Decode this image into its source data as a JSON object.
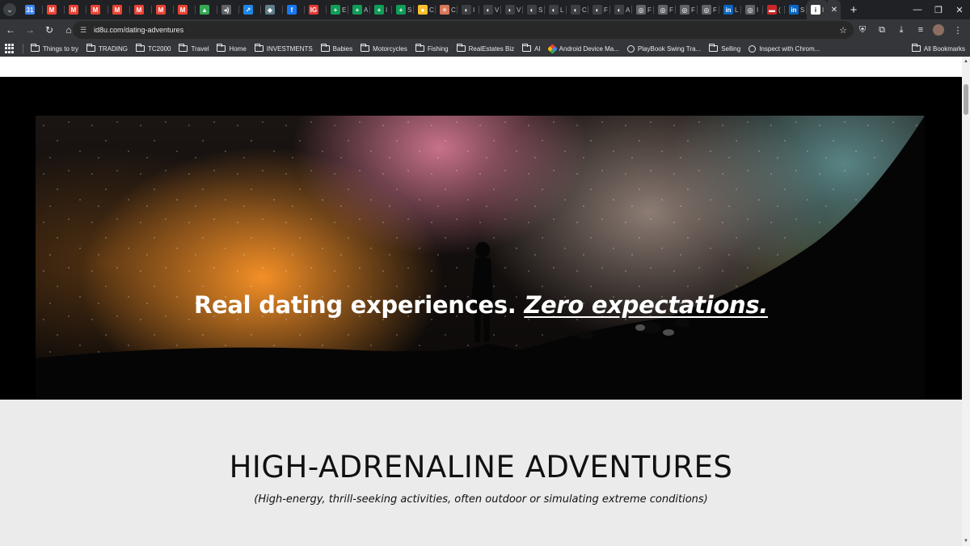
{
  "browser": {
    "tabs": [
      {
        "icon": "calendar-icon",
        "color": "#4285f4",
        "glyph": "31",
        "label": ""
      },
      {
        "icon": "gmail-icon",
        "color": "#ea4335",
        "glyph": "M",
        "label": ""
      },
      {
        "icon": "gmail-icon",
        "color": "#ea4335",
        "glyph": "M",
        "label": ""
      },
      {
        "icon": "gmail-icon",
        "color": "#ea4335",
        "glyph": "M",
        "label": ""
      },
      {
        "icon": "gmail-icon",
        "color": "#ea4335",
        "glyph": "M",
        "label": ""
      },
      {
        "icon": "gmail-icon",
        "color": "#ea4335",
        "glyph": "M",
        "label": ""
      },
      {
        "icon": "gmail-icon",
        "color": "#ea4335",
        "glyph": "M",
        "label": ""
      },
      {
        "icon": "gmail-icon",
        "color": "#ea4335",
        "glyph": "M",
        "label": ""
      },
      {
        "icon": "drive-icon",
        "color": "#34a853",
        "glyph": "▲",
        "label": ""
      },
      {
        "icon": "audio-icon",
        "color": "#5f6368",
        "glyph": "◂)",
        "label": ""
      },
      {
        "icon": "chart-tab-icon",
        "color": "#1e88e5",
        "glyph": "↗",
        "label": ""
      },
      {
        "icon": "shield-tab-icon",
        "color": "#607d8b",
        "glyph": "◆",
        "label": ""
      },
      {
        "icon": "facebook-icon",
        "color": "#1877f2",
        "glyph": "f",
        "label": ""
      },
      {
        "icon": "ig-icon",
        "color": "#e53935",
        "glyph": "IG",
        "label": ""
      },
      {
        "icon": "sheets-icon",
        "color": "#0f9d58",
        "glyph": "+",
        "label": "E"
      },
      {
        "icon": "sheets-icon",
        "color": "#0f9d58",
        "glyph": "+",
        "label": "A"
      },
      {
        "icon": "sheets-icon",
        "color": "#0f9d58",
        "glyph": "+",
        "label": "I"
      },
      {
        "icon": "sheets-icon",
        "color": "#0f9d58",
        "glyph": "+",
        "label": "S"
      },
      {
        "icon": "yellow-circle-icon",
        "color": "#fbc02d",
        "glyph": "●",
        "label": "C"
      },
      {
        "icon": "claude-icon",
        "color": "#d97757",
        "glyph": "✳",
        "label": "C"
      },
      {
        "icon": "github-icon",
        "color": "#3c4043",
        "glyph": "◐",
        "label": "I"
      },
      {
        "icon": "github-icon",
        "color": "#3c4043",
        "glyph": "◐",
        "label": "V"
      },
      {
        "icon": "github-icon",
        "color": "#3c4043",
        "glyph": "◐",
        "label": "V"
      },
      {
        "icon": "github-icon",
        "color": "#3c4043",
        "glyph": "◐",
        "label": "S"
      },
      {
        "icon": "github-icon",
        "color": "#3c4043",
        "glyph": "◐",
        "label": "L"
      },
      {
        "icon": "github-icon",
        "color": "#3c4043",
        "glyph": "◐",
        "label": "C"
      },
      {
        "icon": "github-icon",
        "color": "#3c4043",
        "glyph": "◐",
        "label": "F"
      },
      {
        "icon": "github-icon",
        "color": "#3c4043",
        "glyph": "◐",
        "label": "A"
      },
      {
        "icon": "globe-tab-icon",
        "color": "#5f6368",
        "glyph": "◎",
        "label": "F"
      },
      {
        "icon": "globe-tab-icon",
        "color": "#5f6368",
        "glyph": "◎",
        "label": "F"
      },
      {
        "icon": "globe-tab-icon",
        "color": "#5f6368",
        "glyph": "◎",
        "label": "F"
      },
      {
        "icon": "globe-tab-icon",
        "color": "#5f6368",
        "glyph": "◎",
        "label": "F"
      },
      {
        "icon": "linkedin-icon",
        "color": "#0a66c2",
        "glyph": "in",
        "label": "L"
      },
      {
        "icon": "globe-tab-icon",
        "color": "#5f6368",
        "glyph": "◎",
        "label": "I"
      },
      {
        "icon": "flag-tab-icon",
        "color": "#c62828",
        "glyph": "▬",
        "label": "("
      },
      {
        "icon": "linkedin-icon",
        "color": "#0a66c2",
        "glyph": "in",
        "label": "S"
      }
    ],
    "active_tab_label": "I",
    "active_tab_close": "✕",
    "new_tab": "+",
    "window": {
      "minimize": "—",
      "restore": "❐",
      "close": "✕"
    },
    "toolbar": {
      "back": "←",
      "forward": "→",
      "reload": "↻",
      "home": "⌂",
      "site_info": "☰",
      "url": "id8u.com/dating-adventures",
      "bookmark_star": "☆",
      "extensions": [
        "shield-ext-icon",
        "puzzle-icon",
        "download-icon",
        "media-icon"
      ],
      "extension_glyphs": [
        "⛨",
        "⧉",
        "⤓",
        "≡"
      ],
      "menu": "⋮"
    },
    "bookmarks": [
      {
        "label": "Things to try",
        "type": "folder"
      },
      {
        "label": "TRADING",
        "type": "folder"
      },
      {
        "label": "TC2000",
        "type": "folder"
      },
      {
        "label": "Travel",
        "type": "folder"
      },
      {
        "label": "Home",
        "type": "folder"
      },
      {
        "label": "INVESTMENTS",
        "type": "folder"
      },
      {
        "label": "Babies",
        "type": "folder"
      },
      {
        "label": "Motorcycles",
        "type": "folder"
      },
      {
        "label": "Fishing",
        "type": "folder"
      },
      {
        "label": "RealEstates Biz",
        "type": "folder"
      },
      {
        "label": "AI",
        "type": "folder"
      },
      {
        "label": "Android Device Ma...",
        "type": "adm"
      },
      {
        "label": "PlayBook Swing Tra...",
        "type": "globe"
      },
      {
        "label": "Selling",
        "type": "folder"
      },
      {
        "label": "Inspect with Chrom...",
        "type": "globe"
      }
    ],
    "all_bookmarks": "All Bookmarks"
  },
  "page": {
    "hero": {
      "text_plain": "Real dating experiences. ",
      "text_emphasis": "Zero expectations."
    },
    "section": {
      "title": "HIGH-ADRENALINE ADVENTURES",
      "subtitle": "(High-energy, thrill-seeking activities, often outdoor or simulating extreme conditions)"
    }
  },
  "scrollbar": {
    "up": "▲",
    "down": "▼"
  }
}
